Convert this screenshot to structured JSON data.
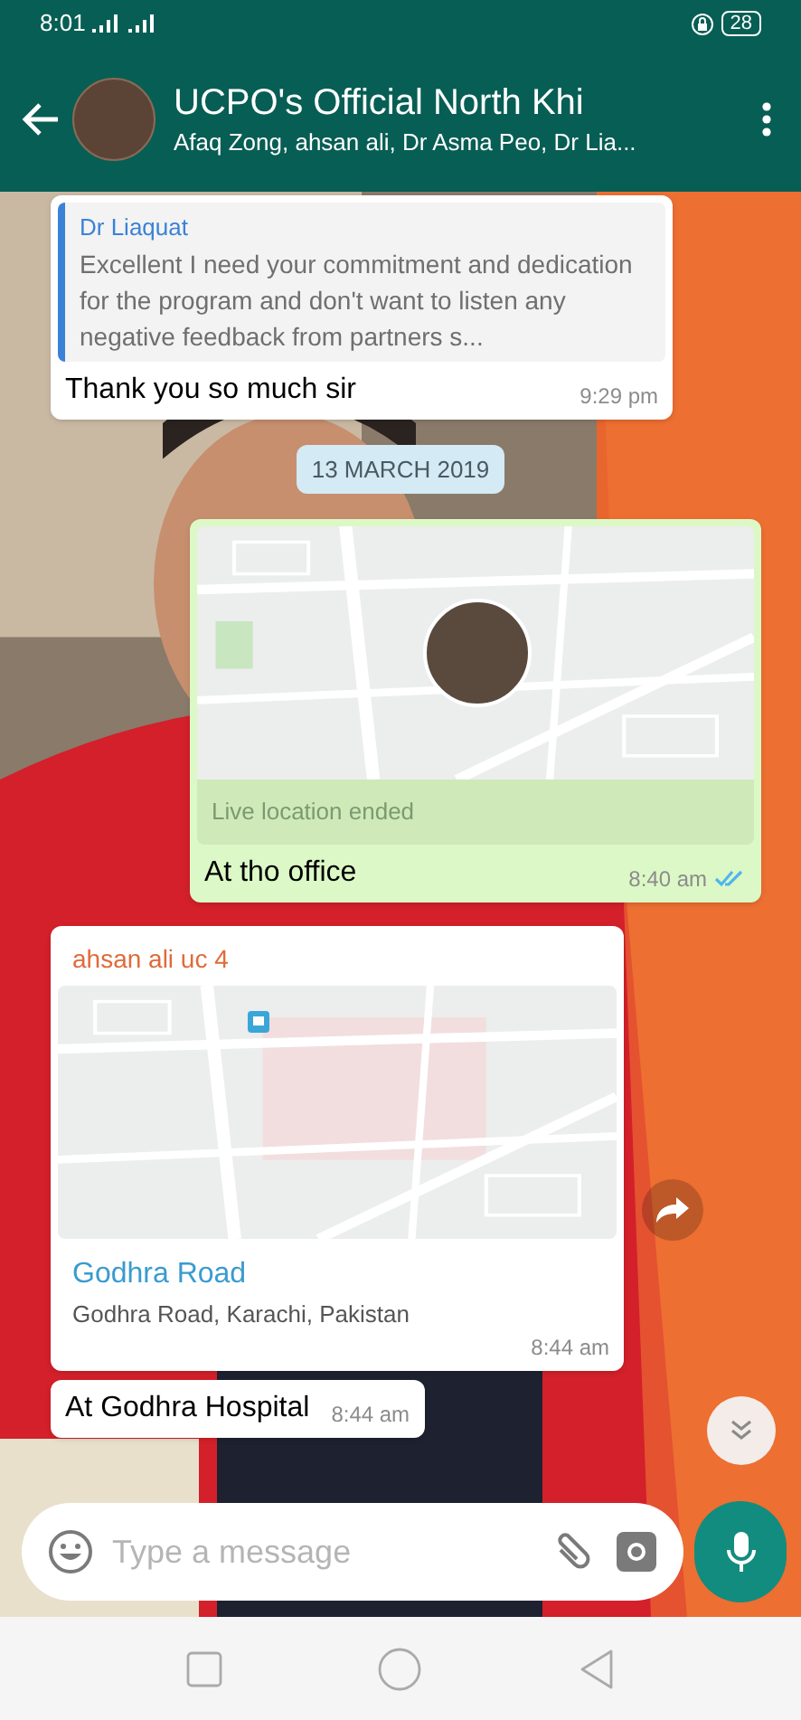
{
  "status_bar": {
    "time": "8:01",
    "battery": "28"
  },
  "header": {
    "title": "UCPO's Official North Khi",
    "subtitle": "Afaq Zong, ahsan ali, Dr Asma Peo, Dr Lia..."
  },
  "messages": [
    {
      "kind": "quote",
      "outgoing": false,
      "quoted_author": "Dr Liaquat",
      "quoted_text": "Excellent I need your commitment and dedication for the program and don't want to listen any negative feedback from partners s...",
      "text": "Thank you so much sir",
      "time": "9:29 pm"
    },
    {
      "kind": "date",
      "text": "13 MARCH 2019"
    },
    {
      "kind": "live_location",
      "outgoing": true,
      "status": "Live location ended",
      "text": "At tho office",
      "time": "8:40 am",
      "read": true
    },
    {
      "kind": "place",
      "outgoing": false,
      "sender": "ahsan ali uc 4",
      "place_name": "Godhra Road",
      "address": "Godhra Road, Karachi, Pakistan",
      "time": "8:44 am"
    },
    {
      "kind": "text",
      "outgoing": false,
      "text": "At Godhra Hospital",
      "time": "8:44 am"
    }
  ],
  "composer": {
    "placeholder": "Type a message"
  }
}
